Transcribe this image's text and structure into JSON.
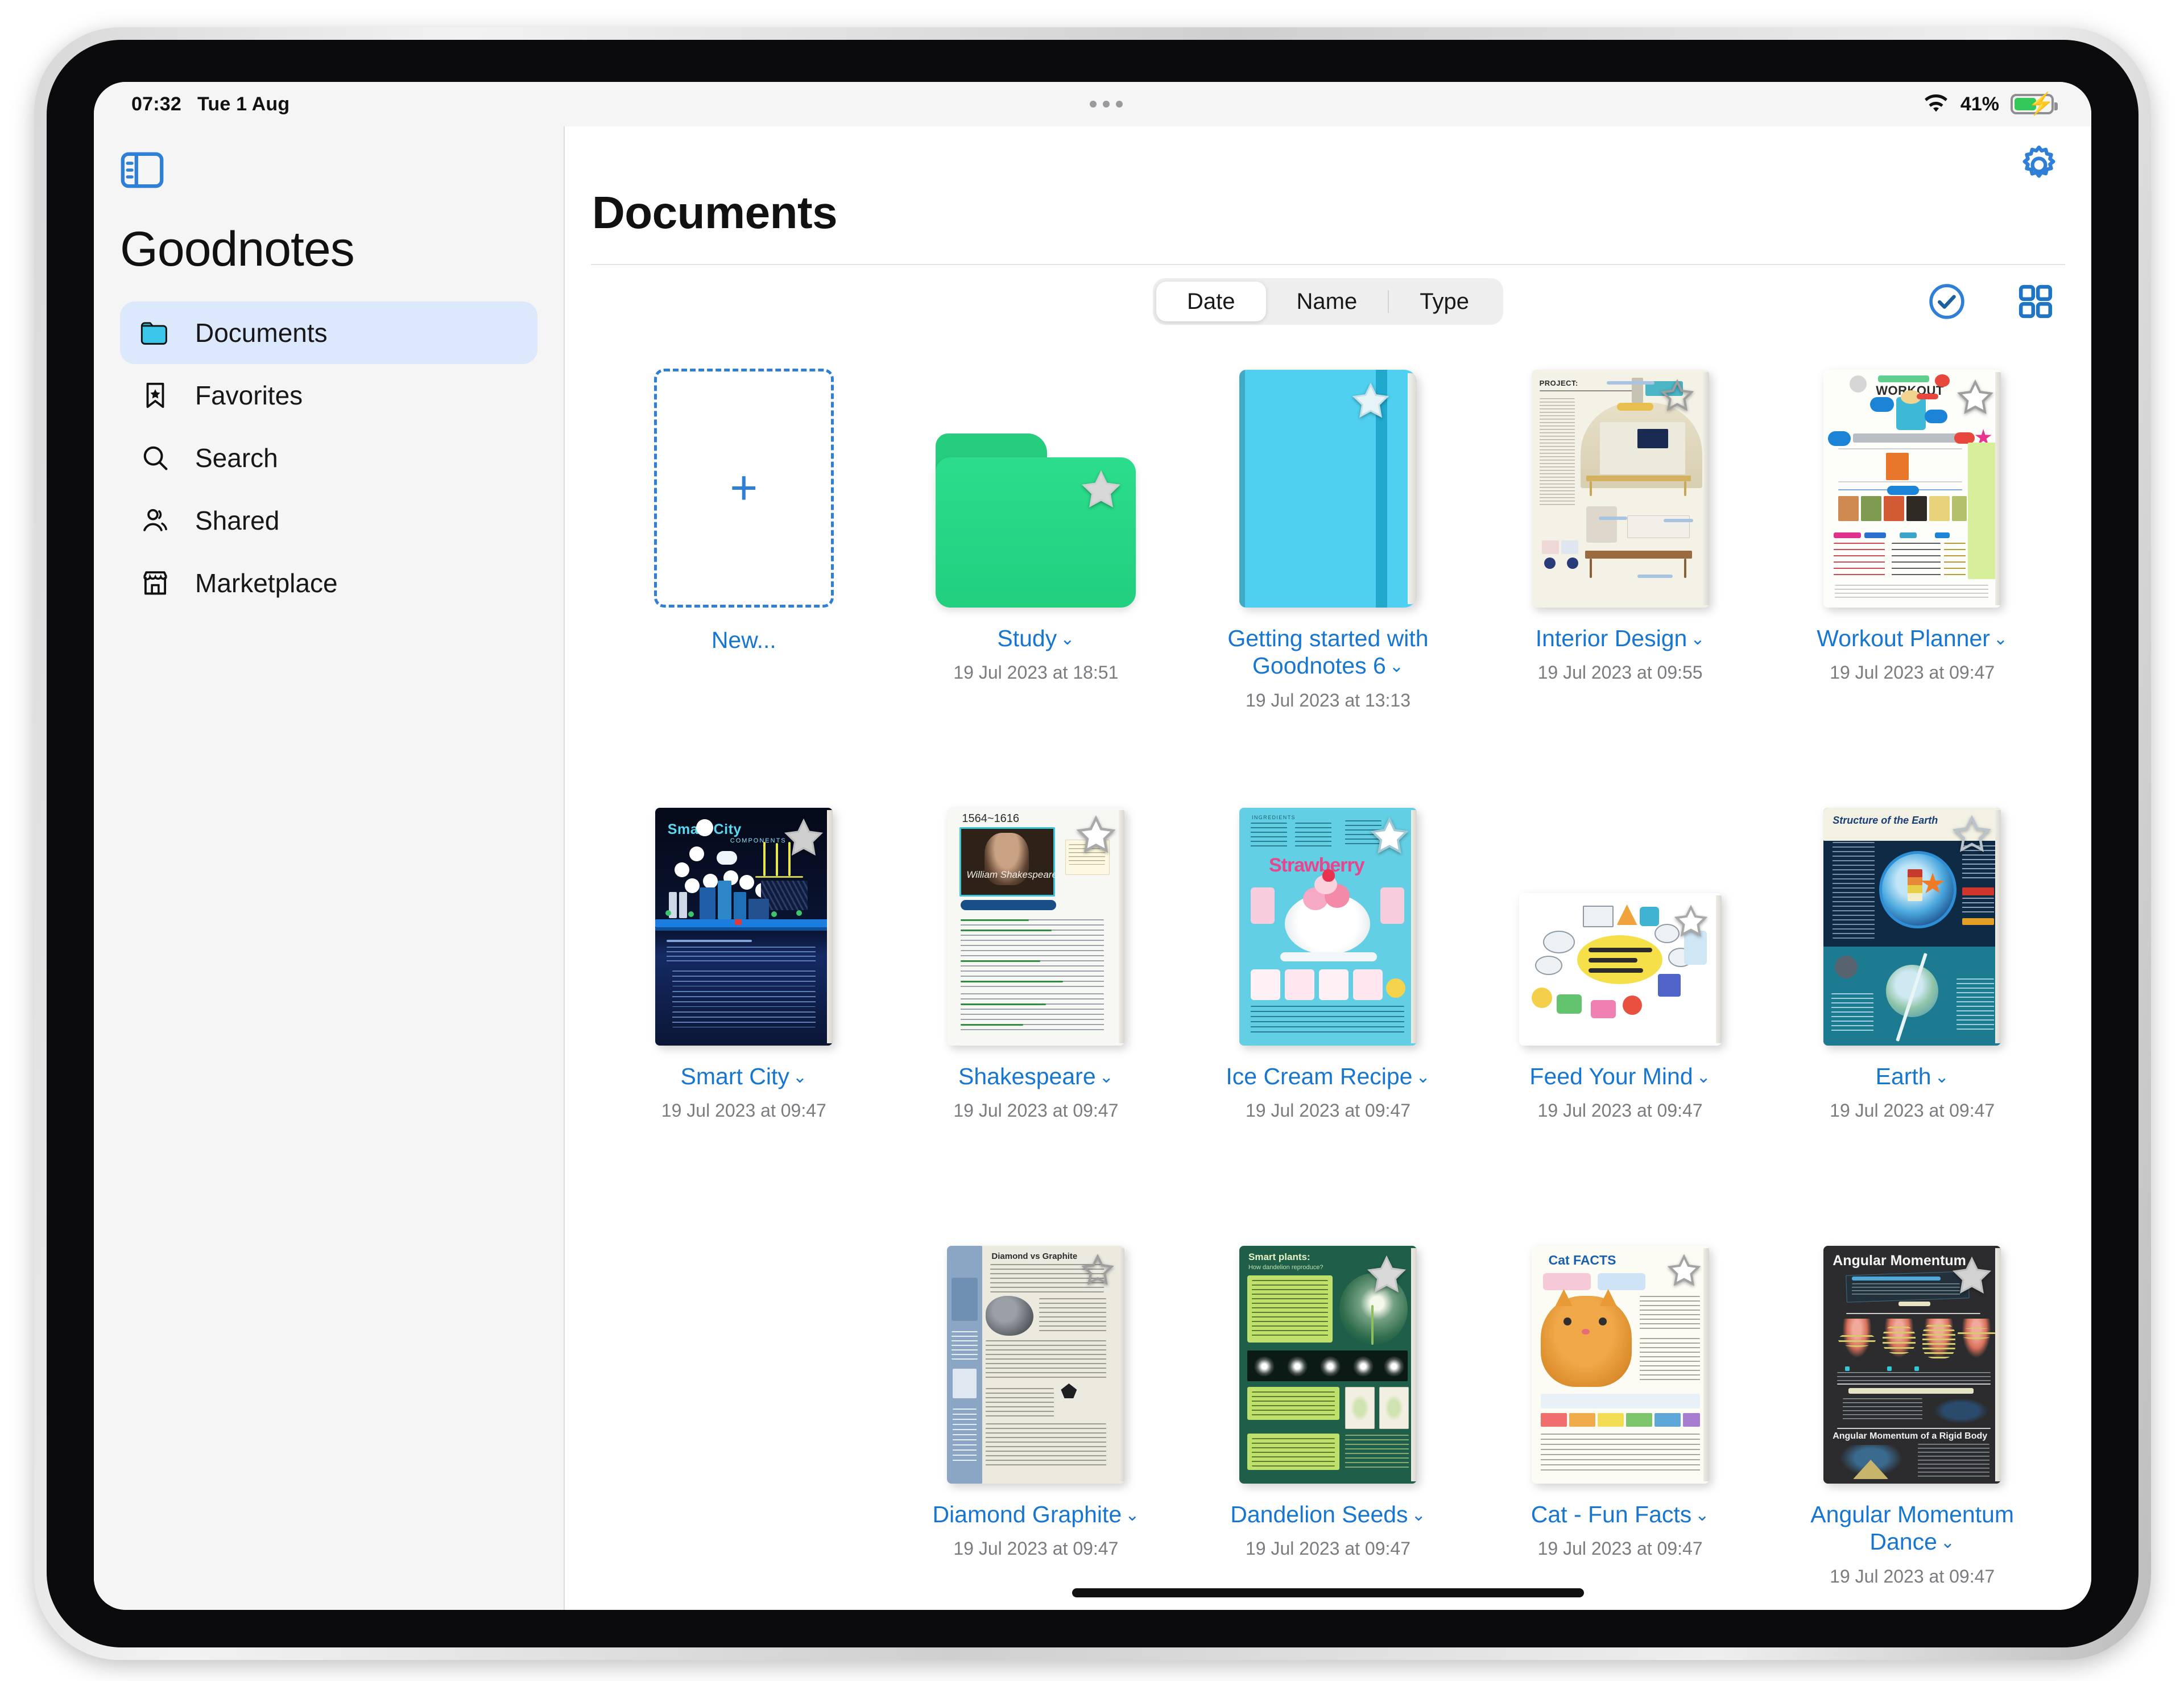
{
  "status_bar": {
    "time": "07:32",
    "date": "Tue 1 Aug",
    "battery_percent": "41%",
    "wifi_icon": "wifi-icon",
    "battery_icon": "battery-charging-icon"
  },
  "sidebar": {
    "toggle_icon": "sidebar-toggle-icon",
    "app_title": "Goodnotes",
    "items": [
      {
        "label": "Documents",
        "icon": "folder-icon",
        "active": true
      },
      {
        "label": "Favorites",
        "icon": "bookmark-star-icon",
        "active": false
      },
      {
        "label": "Search",
        "icon": "search-icon",
        "active": false
      },
      {
        "label": "Shared",
        "icon": "people-icon",
        "active": false
      },
      {
        "label": "Marketplace",
        "icon": "store-icon",
        "active": false
      }
    ]
  },
  "content": {
    "page_title": "Documents",
    "settings_icon": "gear-icon",
    "sort": {
      "options": [
        "Date",
        "Name",
        "Type"
      ],
      "selected": "Date"
    },
    "toolbar_right": [
      {
        "icon": "check-circle-icon",
        "name": "select-items-button"
      },
      {
        "icon": "grid-view-icon",
        "name": "grid-view-button"
      }
    ],
    "new_item": {
      "label": "New...",
      "icon": "plus-icon"
    }
  },
  "documents": [
    {
      "title": "Study",
      "date": "19 Jul 2023 at 18:51",
      "kind": "folder",
      "favorite": true,
      "chevron": "⌄"
    },
    {
      "title": "Getting started with Goodnotes 6",
      "date": "19 Jul 2023 at 13:13",
      "kind": "notebook",
      "favorite": true,
      "chevron": "⌄"
    },
    {
      "title": "Interior Design",
      "date": "19 Jul 2023 at 09:55",
      "kind": "page",
      "favorite": true,
      "chevron": "⌄"
    },
    {
      "title": "Workout Planner",
      "date": "19 Jul 2023 at 09:47",
      "kind": "page",
      "favorite": true,
      "chevron": "⌄"
    },
    {
      "title": "Smart City",
      "date": "19 Jul 2023 at 09:47",
      "kind": "page",
      "favorite": true,
      "chevron": "⌄"
    },
    {
      "title": "Shakespeare",
      "date": "19 Jul 2023 at 09:47",
      "kind": "page",
      "favorite": true,
      "chevron": "⌄"
    },
    {
      "title": "Ice Cream Recipe",
      "date": "19 Jul 2023 at 09:47",
      "kind": "page",
      "favorite": true,
      "chevron": "⌄"
    },
    {
      "title": "Feed Your Mind",
      "date": "19 Jul 2023 at 09:47",
      "kind": "page-wide",
      "favorite": true,
      "chevron": "⌄"
    },
    {
      "title": "Earth",
      "date": "19 Jul 2023 at 09:47",
      "kind": "page",
      "favorite": true,
      "chevron": "⌄"
    },
    {
      "title": "Diamond Graphite",
      "date": "19 Jul 2023 at 09:47",
      "kind": "page",
      "favorite": true,
      "chevron": "⌄"
    },
    {
      "title": "Dandelion Seeds",
      "date": "19 Jul 2023 at 09:47",
      "kind": "page",
      "favorite": true,
      "chevron": "⌄"
    },
    {
      "title": "Cat - Fun Facts",
      "date": "19 Jul 2023 at 09:47",
      "kind": "page",
      "favorite": true,
      "chevron": "⌄"
    },
    {
      "title": "Angular Momentum Dance",
      "date": "19 Jul 2023 at 09:47",
      "kind": "page",
      "favorite": true,
      "chevron": "⌄"
    }
  ],
  "thumbnail_text": {
    "interior_design": "PROJECT:",
    "workout_planner": "WORKOUT",
    "smart_city": "Smart City",
    "smart_city_sub": "COMPONENTS",
    "shakespeare_years": "1564~1616",
    "shakespeare_name": "William Shakespeare",
    "ice_cream": "Strawberry",
    "ice_cream_top": "INGREDIENTS",
    "dandelion": "Smart plants:",
    "dandelion_sub": "How dandelion reproduce?",
    "cat": "Cat FACTS",
    "angular_title": "Angular Momentum",
    "angular_sub": "Angular Momentum of a Rigid Body",
    "earth_title": "Structure of the Earth",
    "diamond_title": "Diamond vs Graphite"
  },
  "colors": {
    "accent_blue": "#1776d1",
    "folder_green": "#21cf7f",
    "notebook_cyan": "#4fd0f0",
    "active_nav_bg": "#dce8fb",
    "battery_green": "#34c759"
  }
}
